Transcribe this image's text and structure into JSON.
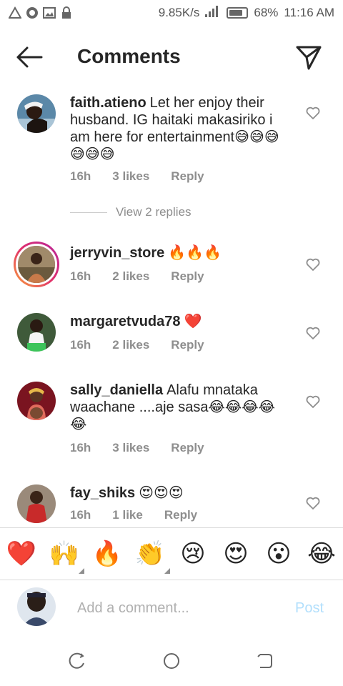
{
  "status_bar": {
    "speed": "9.85K/s",
    "battery": "68%",
    "time": "11:16 AM",
    "icons": [
      "alert-icon",
      "whatsapp-icon",
      "gallery-icon",
      "lock-icon",
      "signal-icon",
      "signal-icon",
      "battery-icon"
    ]
  },
  "header": {
    "title": "Comments",
    "back_icon": "back-arrow-icon",
    "send_icon": "send-icon"
  },
  "comments": [
    {
      "username": "faith.atieno",
      "text": "Let her enjoy their husband. IG haitaki makasiriko i am here for entertainment😅😅😅😅😅😅",
      "time": "16h",
      "likes": "3 likes",
      "reply": "Reply",
      "view_replies": "View 2 replies"
    },
    {
      "username": "jerryvin_store",
      "text": "🔥🔥🔥",
      "time": "16h",
      "likes": "2 likes",
      "reply": "Reply"
    },
    {
      "username": "margaretvuda78",
      "text": "❤️",
      "time": "16h",
      "likes": "2 likes",
      "reply": "Reply"
    },
    {
      "username": "sally_daniella",
      "text": "Alafu mnataka waachane ....aje sasa😂😂😂😂😂",
      "time": "16h",
      "likes": "3 likes",
      "reply": "Reply"
    },
    {
      "username": "fay_shiks",
      "text": "😍😍😍",
      "time": "16h",
      "likes": "1 like",
      "reply": "Reply"
    }
  ],
  "emoji_bar": [
    "❤️",
    "🙌",
    "🔥",
    "👏",
    "😢",
    "😍",
    "😮",
    "😂"
  ],
  "add_comment": {
    "placeholder": "Add a comment...",
    "post_label": "Post"
  },
  "colors": {
    "text": "#262626",
    "muted": "#8e8e8e",
    "post_disabled": "#b2dffc",
    "heart": "#e0245e"
  }
}
